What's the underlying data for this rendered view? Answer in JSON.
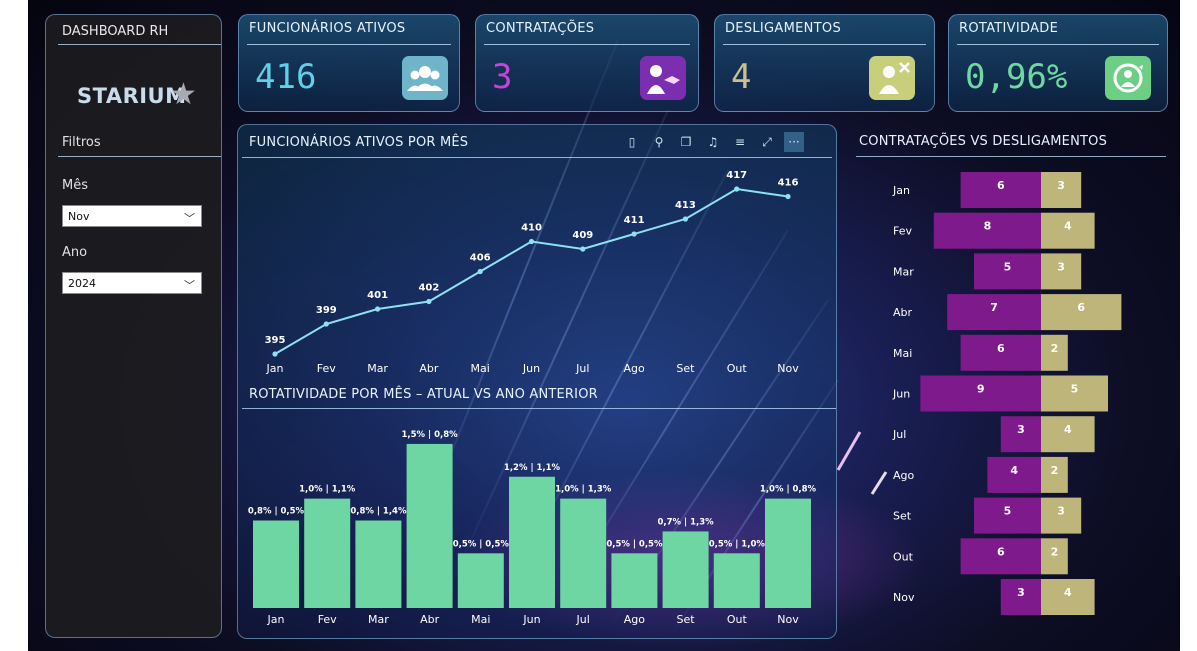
{
  "sidebar": {
    "title": "DASHBOARD RH",
    "logo": "STARIUM",
    "filters_label": "Filtros",
    "month_label": "Mês",
    "month_value": "Nov",
    "year_label": "Ano",
    "year_value": "2024"
  },
  "kpis": [
    {
      "title": "FUNCIONÁRIOS ATIVOS",
      "value": "416",
      "color": "#5fd0e6",
      "icon": "people-icon",
      "icon_bg": "#6fb4c9"
    },
    {
      "title": "CONTRATAÇÕES",
      "value": "3",
      "color": "#c545d8",
      "icon": "handshake-icon",
      "icon_bg": "#7b2fb0"
    },
    {
      "title": "DESLIGAMENTOS",
      "value": "4",
      "color": "#c9c08e",
      "icon": "user-remove-icon",
      "icon_bg": "#c7cf7b"
    },
    {
      "title": "ROTATIVIDADE",
      "value": "0,96%",
      "color": "#6fd8a0",
      "icon": "rotation-icon",
      "icon_bg": "#6ccf83"
    }
  ],
  "line_section_title": "FUNCIONÁRIOS ATIVOS POR MÊS",
  "bar_section_title": "ROTATIVIDADE POR MÊS – ATUAL VS ANO ANTERIOR",
  "hbar_section_title": "CONTRATAÇÕES VS DESLIGAMENTOS",
  "toolbar_icons": [
    "page-icon",
    "pin-icon",
    "copy-icon",
    "bell-icon",
    "filter-icon",
    "focus-icon",
    "more-icon"
  ],
  "chart_data": [
    {
      "type": "line",
      "x": [
        "Jan",
        "Fev",
        "Mar",
        "Abr",
        "Mai",
        "Jun",
        "Jul",
        "Ago",
        "Set",
        "Out",
        "Nov"
      ],
      "values": [
        395,
        399,
        401,
        402,
        406,
        410,
        409,
        411,
        413,
        417,
        416
      ],
      "color": "#8fe1f2"
    },
    {
      "type": "bar",
      "categories": [
        "Jan",
        "Fev",
        "Mar",
        "Abr",
        "Mai",
        "Jun",
        "Jul",
        "Ago",
        "Set",
        "Out",
        "Nov"
      ],
      "values": [
        0.8,
        1.0,
        0.8,
        1.5,
        0.5,
        1.2,
        1.0,
        0.5,
        0.7,
        0.5,
        1.0
      ],
      "labels": [
        "0,8% | 0,5%",
        "1,0% | 1,1%",
        "0,8% | 1,4%",
        "1,5% | 0,8%",
        "0,5% | 0,5%",
        "1,2% | 1,1%",
        "1,0% | 1,3%",
        "0,5% | 0,5%",
        "0,7% | 1,3%",
        "0,5% | 1,0%",
        "1,0% | 0,8%"
      ],
      "ylim": [
        0,
        1.6
      ],
      "color": "#6ed6a2"
    },
    {
      "type": "bar",
      "orientation": "horizontal",
      "categories": [
        "Jan",
        "Fev",
        "Mar",
        "Abr",
        "Mai",
        "Jun",
        "Jul",
        "Ago",
        "Set",
        "Out",
        "Nov"
      ],
      "series": [
        {
          "values": [
            6,
            8,
            5,
            7,
            6,
            9,
            3,
            4,
            5,
            6,
            3
          ],
          "color": "#7f1a8c"
        },
        {
          "values": [
            3,
            4,
            3,
            6,
            2,
            5,
            4,
            2,
            3,
            2,
            4
          ],
          "color": "#bdb57a"
        }
      ]
    }
  ]
}
